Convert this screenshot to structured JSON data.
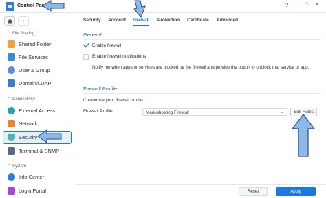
{
  "window": {
    "title": "Control Panel",
    "help": "?",
    "minimize": "–",
    "maximize": "□",
    "close": "×"
  },
  "sidebar": {
    "sections": [
      {
        "label": "File Sharing"
      },
      {
        "label": "Connectivity"
      },
      {
        "label": "System"
      }
    ],
    "items": [
      {
        "label": "Shared Folder",
        "icon": "shared-folder-icon",
        "color": "#e8a33a"
      },
      {
        "label": "File Services",
        "icon": "file-services-icon",
        "color": "#3b8ad8"
      },
      {
        "label": "User & Group",
        "icon": "user-group-icon",
        "color": "#5a8fd6"
      },
      {
        "label": "Domain/LDAP",
        "icon": "domain-ldap-icon",
        "color": "#3d7dc9"
      },
      {
        "label": "External Access",
        "icon": "external-access-icon",
        "color": "#26a6a0"
      },
      {
        "label": "Network",
        "icon": "network-icon",
        "color": "#e2873a"
      },
      {
        "label": "Security",
        "icon": "security-shield-icon",
        "color": "#4cb5b0"
      },
      {
        "label": "Terminal & SNMP",
        "icon": "terminal-icon",
        "color": "#5a6b7d"
      },
      {
        "label": "Info Center",
        "icon": "info-center-icon",
        "color": "#2f7fd5"
      },
      {
        "label": "Login Portal",
        "icon": "login-portal-icon",
        "color": "#9b4fd0"
      }
    ]
  },
  "tabs": [
    {
      "label": "Security"
    },
    {
      "label": "Account"
    },
    {
      "label": "Firewall"
    },
    {
      "label": "Protection"
    },
    {
      "label": "Certificate"
    },
    {
      "label": "Advanced"
    }
  ],
  "general": {
    "heading": "General",
    "enable_firewall": "Enable firewall",
    "enable_notifications": "Enable firewall notifications",
    "notify_desc": "Notify me when apps or services are blocked by the firewall and provide the option to unblock that service or app."
  },
  "profile": {
    "heading": "Firewall Profile",
    "customize": "Customize your firewall profile.",
    "label": "Firewall Profile:",
    "value": "Mariushosting Firewall",
    "edit_rules": "Edit Rules"
  },
  "footer": {
    "reset": "Reset",
    "apply": "Apply"
  },
  "colors": {
    "accent": "#1b78e0",
    "arrow_fill": "#8fb8e8",
    "arrow_stroke": "#1a4f8f"
  }
}
